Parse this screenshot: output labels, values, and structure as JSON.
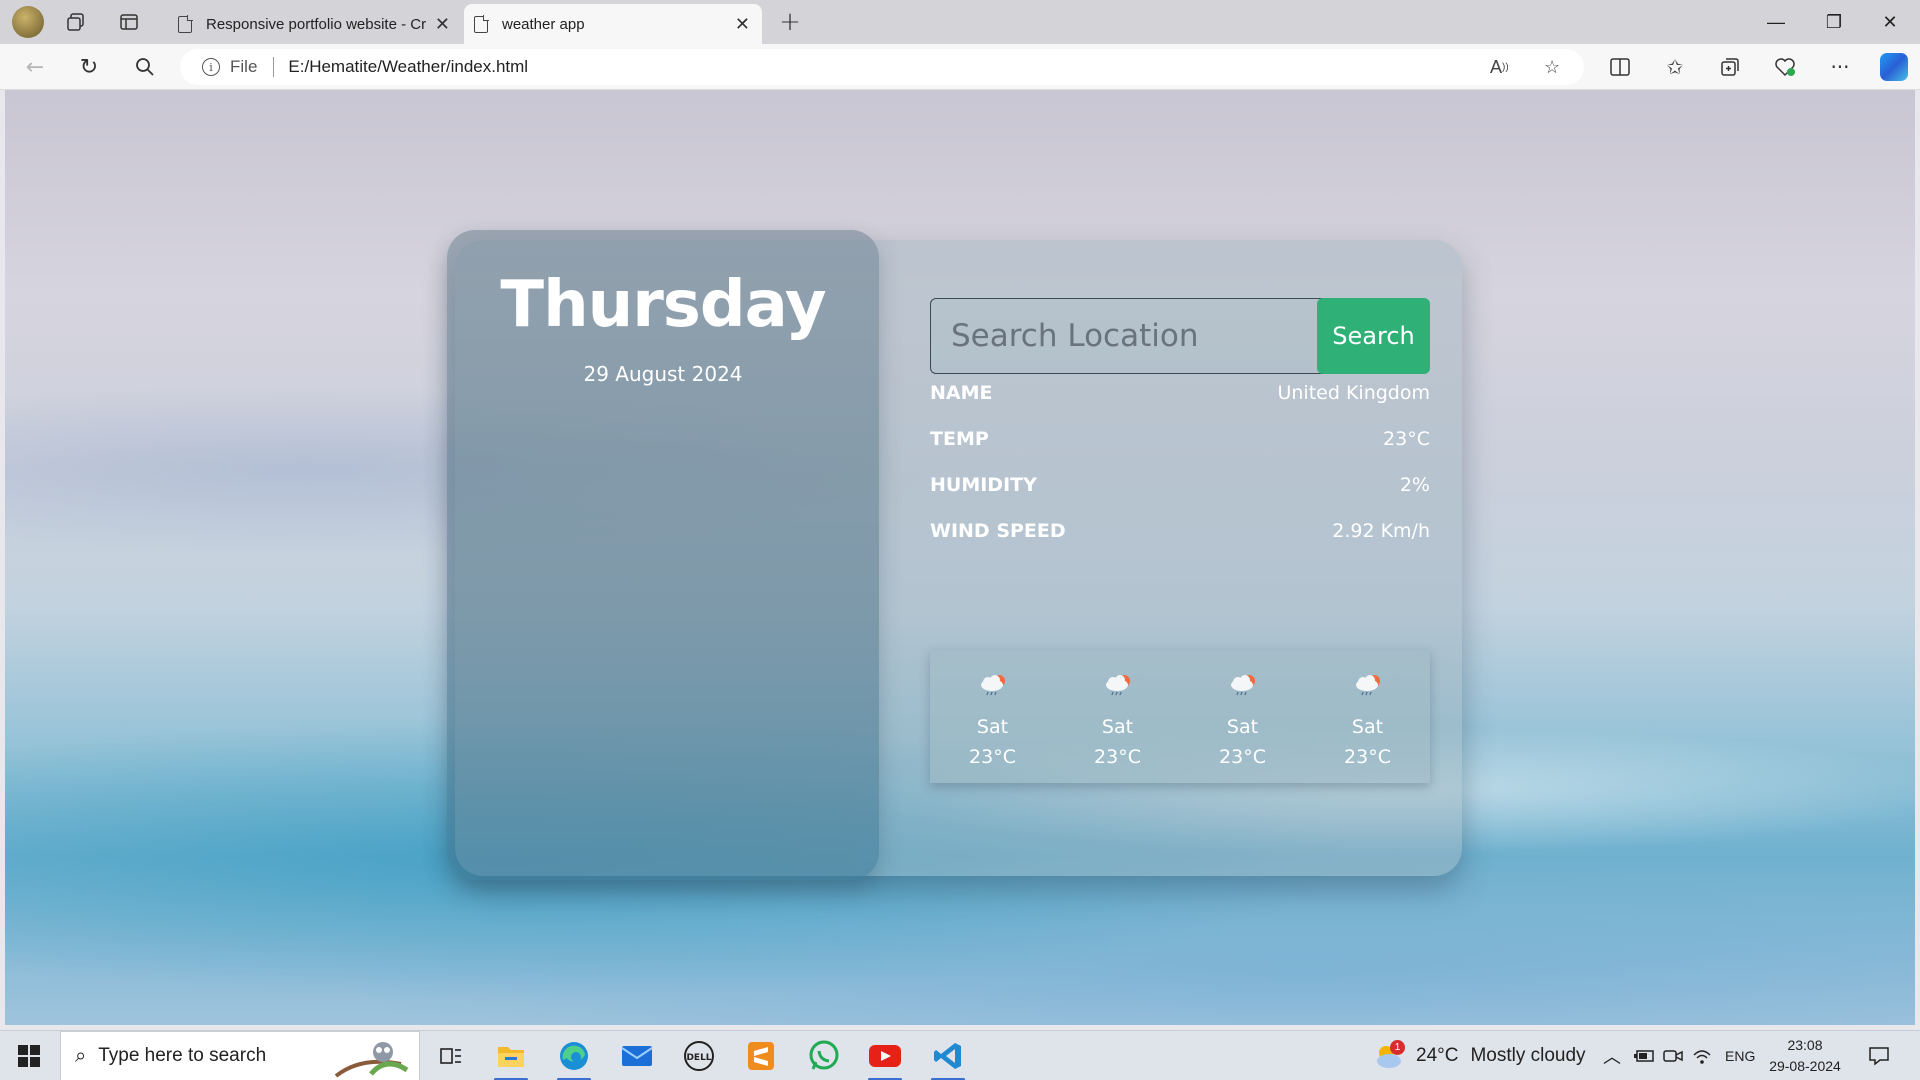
{
  "browser": {
    "tabs": [
      {
        "title": "Responsive portfolio website - Cr",
        "active": false
      },
      {
        "title": "weather app",
        "active": true
      }
    ],
    "address": {
      "scheme_label": "File",
      "url": "E:/Hematite/Weather/index.html"
    },
    "window_controls": {
      "minimize": "—",
      "restore": "❐",
      "close": "✕"
    }
  },
  "weather": {
    "day": "Thursday",
    "date": "29 August 2024",
    "search": {
      "placeholder": "Search Location",
      "button_label": "Search"
    },
    "details": [
      {
        "label": "NAME",
        "value": "United Kingdom"
      },
      {
        "label": "TEMP",
        "value": "23°C"
      },
      {
        "label": "HUMIDITY",
        "value": "2%"
      },
      {
        "label": "WIND SPEED",
        "value": "2.92 Km/h"
      }
    ],
    "forecast": [
      {
        "day": "Sat",
        "temp": "23°C",
        "icon": "cloud-rain-sun-icon"
      },
      {
        "day": "Sat",
        "temp": "23°C",
        "icon": "cloud-rain-sun-icon"
      },
      {
        "day": "Sat",
        "temp": "23°C",
        "icon": "cloud-rain-sun-icon"
      },
      {
        "day": "Sat",
        "temp": "23°C",
        "icon": "cloud-rain-sun-icon"
      }
    ]
  },
  "taskbar": {
    "search_placeholder": "Type here to search",
    "weather": {
      "temp": "24°C",
      "condition": "Mostly cloudy",
      "alert_count": "1"
    },
    "language": "ENG",
    "time": "23:08",
    "date": "29-08-2024"
  },
  "colors": {
    "search_button": "#2fb077",
    "accent_blue": "#3a6fd0"
  }
}
